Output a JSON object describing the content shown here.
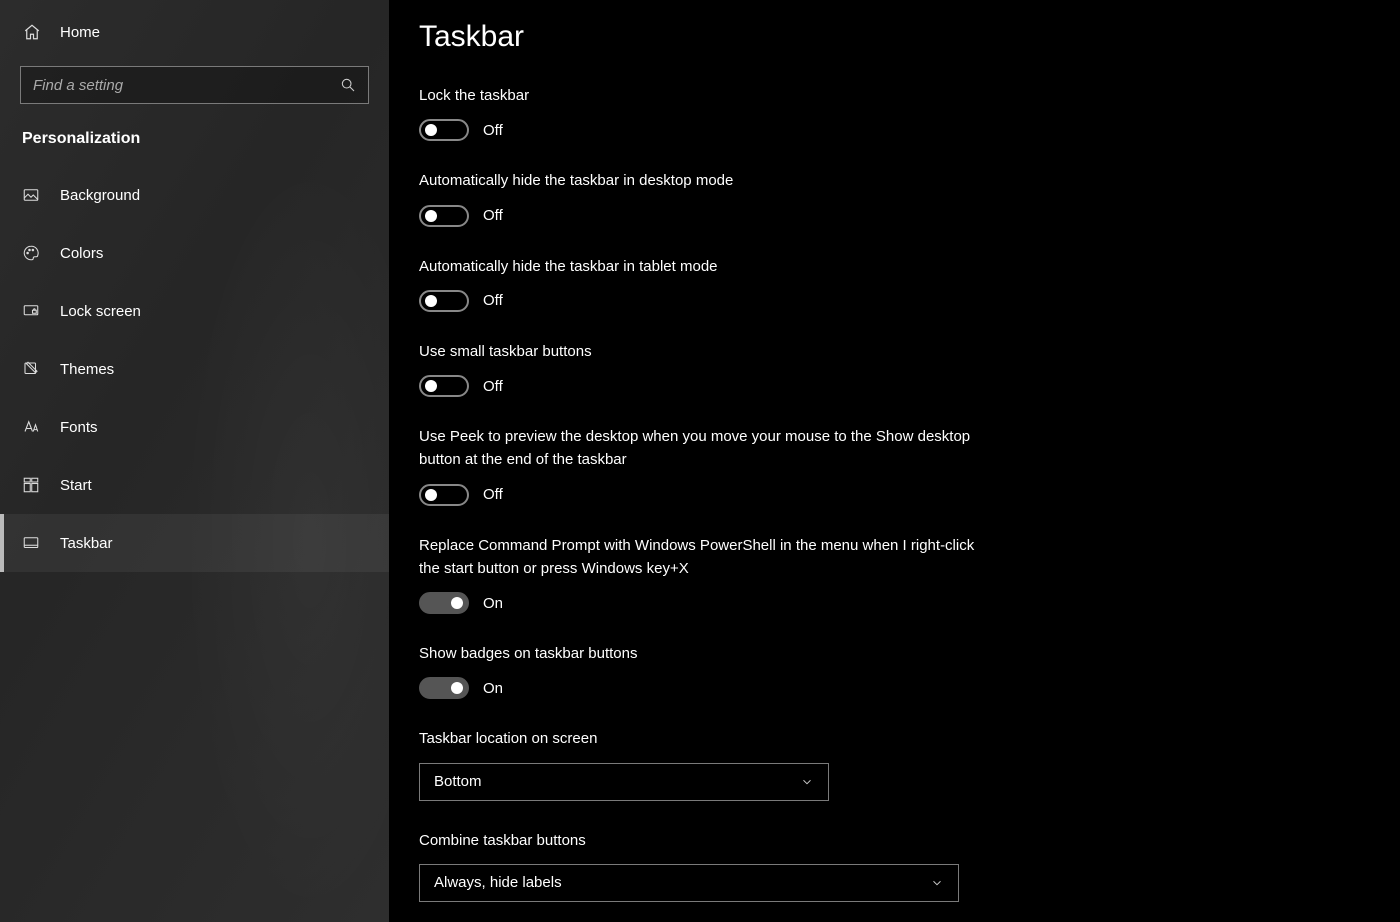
{
  "home_label": "Home",
  "search_placeholder": "Find a setting",
  "category_title": "Personalization",
  "nav": [
    {
      "label": "Background",
      "icon": "image-icon"
    },
    {
      "label": "Colors",
      "icon": "palette-icon"
    },
    {
      "label": "Lock screen",
      "icon": "lockscreen-icon"
    },
    {
      "label": "Themes",
      "icon": "themes-icon"
    },
    {
      "label": "Fonts",
      "icon": "fonts-icon"
    },
    {
      "label": "Start",
      "icon": "start-icon"
    },
    {
      "label": "Taskbar",
      "icon": "taskbar-icon"
    }
  ],
  "active_nav_index": 6,
  "page_title": "Taskbar",
  "off_text": "Off",
  "on_text": "On",
  "settings": {
    "lock": {
      "label": "Lock the taskbar",
      "on": false
    },
    "hide_desktop": {
      "label": "Automatically hide the taskbar in desktop mode",
      "on": false
    },
    "hide_tablet": {
      "label": "Automatically hide the taskbar in tablet mode",
      "on": false
    },
    "small": {
      "label": "Use small taskbar buttons",
      "on": false
    },
    "peek": {
      "label": "Use Peek to preview the desktop when you move your mouse to the Show desktop button at the end of the taskbar",
      "on": false
    },
    "powershell": {
      "label": "Replace Command Prompt with Windows PowerShell in the menu when I right-click the start button or press Windows key+X",
      "on": true
    },
    "badges": {
      "label": "Show badges on taskbar buttons",
      "on": true
    }
  },
  "location": {
    "label": "Taskbar location on screen",
    "value": "Bottom"
  },
  "combine": {
    "label": "Combine taskbar buttons",
    "value": "Always, hide labels"
  }
}
